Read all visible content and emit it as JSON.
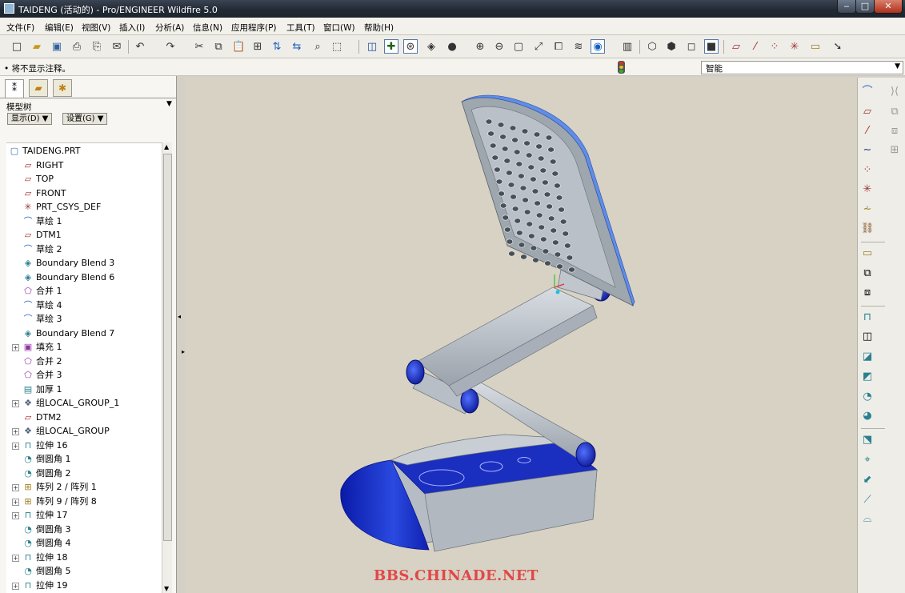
{
  "window": {
    "title": "TAIDENG (活动的) - Pro/ENGINEER Wildfire 5.0"
  },
  "menu": [
    "文件(F)",
    "编辑(E)",
    "视图(V)",
    "插入(I)",
    "分析(A)",
    "信息(N)",
    "应用程序(P)",
    "工具(T)",
    "窗口(W)",
    "帮助(H)"
  ],
  "status": {
    "message": "• 将不显示注释。",
    "filter_value": "智能"
  },
  "model_tree": {
    "label": "模型树",
    "show_button": "显示(D) ▼",
    "settings_button": "设置(G) ▼",
    "items": [
      {
        "label": "TAIDENG.PRT",
        "icon": "part-icon"
      },
      {
        "label": "RIGHT",
        "icon": "datum-plane-icon"
      },
      {
        "label": "TOP",
        "icon": "datum-plane-icon"
      },
      {
        "label": "FRONT",
        "icon": "datum-plane-icon"
      },
      {
        "label": "PRT_CSYS_DEF",
        "icon": "csys-icon"
      },
      {
        "label": "草绘 1",
        "icon": "sketch-icon"
      },
      {
        "label": "DTM1",
        "icon": "datum-plane-icon"
      },
      {
        "label": "草绘 2",
        "icon": "sketch-icon"
      },
      {
        "label": "Boundary Blend 3",
        "icon": "boundary-blend-icon"
      },
      {
        "label": "Boundary Blend 6",
        "icon": "boundary-blend-icon"
      },
      {
        "label": "合并 1",
        "icon": "merge-icon"
      },
      {
        "label": "草绘 4",
        "icon": "sketch-icon"
      },
      {
        "label": "草绘 3",
        "icon": "sketch-icon"
      },
      {
        "label": "Boundary Blend 7",
        "icon": "boundary-blend-icon"
      },
      {
        "label": "填充 1",
        "icon": "fill-icon"
      },
      {
        "label": "合并 2",
        "icon": "merge-icon"
      },
      {
        "label": "合并 3",
        "icon": "merge-icon"
      },
      {
        "label": "加厚 1",
        "icon": "thicken-icon"
      },
      {
        "label": "组LOCAL_GROUP_1",
        "icon": "group-icon"
      },
      {
        "label": "DTM2",
        "icon": "datum-plane-icon"
      },
      {
        "label": "组LOCAL_GROUP",
        "icon": "group-icon"
      },
      {
        "label": "拉伸 16",
        "icon": "extrude-icon"
      },
      {
        "label": "倒圆角 1",
        "icon": "round-icon"
      },
      {
        "label": "倒圆角 2",
        "icon": "round-icon"
      },
      {
        "label": "阵列 2 / 阵列 1",
        "icon": "pattern-icon"
      },
      {
        "label": "阵列 9 / 阵列 8",
        "icon": "pattern-icon"
      },
      {
        "label": "拉伸 17",
        "icon": "extrude-icon"
      },
      {
        "label": "倒圆角 3",
        "icon": "round-icon"
      },
      {
        "label": "倒圆角 4",
        "icon": "round-icon"
      },
      {
        "label": "拉伸 18",
        "icon": "extrude-icon"
      },
      {
        "label": "倒圆角 5",
        "icon": "round-icon"
      },
      {
        "label": "拉伸 19",
        "icon": "extrude-icon"
      }
    ]
  },
  "viewport": {
    "watermark": "BBS.CHINADE.NET",
    "colors": {
      "body": "#c6ccd2",
      "accent": "#1a2ec0",
      "background": "#d7d2c4"
    }
  }
}
